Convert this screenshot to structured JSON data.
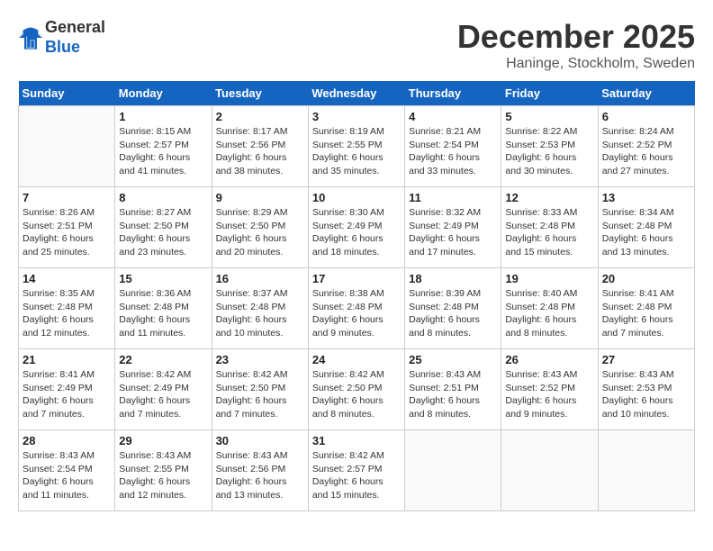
{
  "logo": {
    "general": "General",
    "blue": "Blue"
  },
  "title": "December 2025",
  "location": "Haninge, Stockholm, Sweden",
  "days_of_week": [
    "Sunday",
    "Monday",
    "Tuesday",
    "Wednesday",
    "Thursday",
    "Friday",
    "Saturday"
  ],
  "weeks": [
    [
      {
        "day": "",
        "info": ""
      },
      {
        "day": "1",
        "info": "Sunrise: 8:15 AM\nSunset: 2:57 PM\nDaylight: 6 hours\nand 41 minutes."
      },
      {
        "day": "2",
        "info": "Sunrise: 8:17 AM\nSunset: 2:56 PM\nDaylight: 6 hours\nand 38 minutes."
      },
      {
        "day": "3",
        "info": "Sunrise: 8:19 AM\nSunset: 2:55 PM\nDaylight: 6 hours\nand 35 minutes."
      },
      {
        "day": "4",
        "info": "Sunrise: 8:21 AM\nSunset: 2:54 PM\nDaylight: 6 hours\nand 33 minutes."
      },
      {
        "day": "5",
        "info": "Sunrise: 8:22 AM\nSunset: 2:53 PM\nDaylight: 6 hours\nand 30 minutes."
      },
      {
        "day": "6",
        "info": "Sunrise: 8:24 AM\nSunset: 2:52 PM\nDaylight: 6 hours\nand 27 minutes."
      }
    ],
    [
      {
        "day": "7",
        "info": "Sunrise: 8:26 AM\nSunset: 2:51 PM\nDaylight: 6 hours\nand 25 minutes."
      },
      {
        "day": "8",
        "info": "Sunrise: 8:27 AM\nSunset: 2:50 PM\nDaylight: 6 hours\nand 23 minutes."
      },
      {
        "day": "9",
        "info": "Sunrise: 8:29 AM\nSunset: 2:50 PM\nDaylight: 6 hours\nand 20 minutes."
      },
      {
        "day": "10",
        "info": "Sunrise: 8:30 AM\nSunset: 2:49 PM\nDaylight: 6 hours\nand 18 minutes."
      },
      {
        "day": "11",
        "info": "Sunrise: 8:32 AM\nSunset: 2:49 PM\nDaylight: 6 hours\nand 17 minutes."
      },
      {
        "day": "12",
        "info": "Sunrise: 8:33 AM\nSunset: 2:48 PM\nDaylight: 6 hours\nand 15 minutes."
      },
      {
        "day": "13",
        "info": "Sunrise: 8:34 AM\nSunset: 2:48 PM\nDaylight: 6 hours\nand 13 minutes."
      }
    ],
    [
      {
        "day": "14",
        "info": "Sunrise: 8:35 AM\nSunset: 2:48 PM\nDaylight: 6 hours\nand 12 minutes."
      },
      {
        "day": "15",
        "info": "Sunrise: 8:36 AM\nSunset: 2:48 PM\nDaylight: 6 hours\nand 11 minutes."
      },
      {
        "day": "16",
        "info": "Sunrise: 8:37 AM\nSunset: 2:48 PM\nDaylight: 6 hours\nand 10 minutes."
      },
      {
        "day": "17",
        "info": "Sunrise: 8:38 AM\nSunset: 2:48 PM\nDaylight: 6 hours\nand 9 minutes."
      },
      {
        "day": "18",
        "info": "Sunrise: 8:39 AM\nSunset: 2:48 PM\nDaylight: 6 hours\nand 8 minutes."
      },
      {
        "day": "19",
        "info": "Sunrise: 8:40 AM\nSunset: 2:48 PM\nDaylight: 6 hours\nand 8 minutes."
      },
      {
        "day": "20",
        "info": "Sunrise: 8:41 AM\nSunset: 2:48 PM\nDaylight: 6 hours\nand 7 minutes."
      }
    ],
    [
      {
        "day": "21",
        "info": "Sunrise: 8:41 AM\nSunset: 2:49 PM\nDaylight: 6 hours\nand 7 minutes."
      },
      {
        "day": "22",
        "info": "Sunrise: 8:42 AM\nSunset: 2:49 PM\nDaylight: 6 hours\nand 7 minutes."
      },
      {
        "day": "23",
        "info": "Sunrise: 8:42 AM\nSunset: 2:50 PM\nDaylight: 6 hours\nand 7 minutes."
      },
      {
        "day": "24",
        "info": "Sunrise: 8:42 AM\nSunset: 2:50 PM\nDaylight: 6 hours\nand 8 minutes."
      },
      {
        "day": "25",
        "info": "Sunrise: 8:43 AM\nSunset: 2:51 PM\nDaylight: 6 hours\nand 8 minutes."
      },
      {
        "day": "26",
        "info": "Sunrise: 8:43 AM\nSunset: 2:52 PM\nDaylight: 6 hours\nand 9 minutes."
      },
      {
        "day": "27",
        "info": "Sunrise: 8:43 AM\nSunset: 2:53 PM\nDaylight: 6 hours\nand 10 minutes."
      }
    ],
    [
      {
        "day": "28",
        "info": "Sunrise: 8:43 AM\nSunset: 2:54 PM\nDaylight: 6 hours\nand 11 minutes."
      },
      {
        "day": "29",
        "info": "Sunrise: 8:43 AM\nSunset: 2:55 PM\nDaylight: 6 hours\nand 12 minutes."
      },
      {
        "day": "30",
        "info": "Sunrise: 8:43 AM\nSunset: 2:56 PM\nDaylight: 6 hours\nand 13 minutes."
      },
      {
        "day": "31",
        "info": "Sunrise: 8:42 AM\nSunset: 2:57 PM\nDaylight: 6 hours\nand 15 minutes."
      },
      {
        "day": "",
        "info": ""
      },
      {
        "day": "",
        "info": ""
      },
      {
        "day": "",
        "info": ""
      }
    ]
  ]
}
